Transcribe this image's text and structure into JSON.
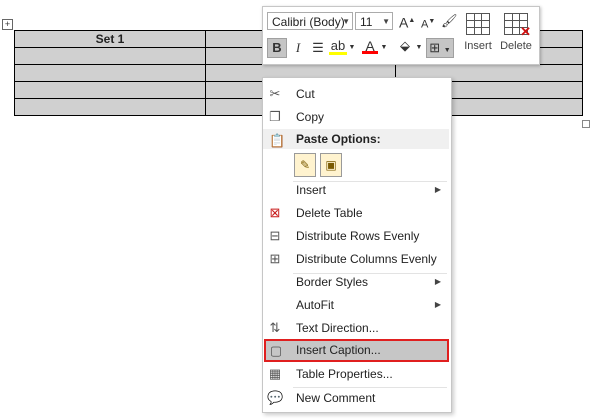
{
  "table": {
    "header_cell": "Set 1"
  },
  "toolbar": {
    "font_name": "Calibri (Body)",
    "font_size": "11",
    "grow_font": "A",
    "shrink_font": "A",
    "bold": "B",
    "italic": "I",
    "font_color_glyph": "A",
    "insert_label": "Insert",
    "delete_label": "Delete",
    "highlight_color": "#ffff00",
    "font_color": "#ff0000"
  },
  "menu": {
    "cut": "Cut",
    "copy": "Copy",
    "paste_options": "Paste Options:",
    "insert": "Insert",
    "delete_table": "Delete Table",
    "distribute_rows": "Distribute Rows Evenly",
    "distribute_columns": "Distribute Columns Evenly",
    "border_styles": "Border Styles",
    "autofit": "AutoFit",
    "text_direction": "Text Direction...",
    "insert_caption": "Insert Caption...",
    "table_properties": "Table Properties...",
    "new_comment": "New Comment",
    "highlight_border_color": "#e01f1f"
  }
}
